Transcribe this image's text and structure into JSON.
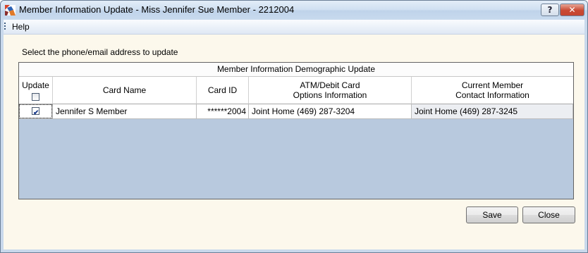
{
  "window": {
    "title": "Member Information Update - Miss Jennifer Sue Member - 2212004",
    "help_glyph": "?",
    "close_glyph": "✕",
    "app_icon": "app-logo-icon"
  },
  "menu": {
    "items": [
      "Help"
    ]
  },
  "instruction": "Select the phone/email address to update",
  "grid": {
    "caption": "Member Information Demographic Update",
    "columns": {
      "update": "Update",
      "card_name": "Card Name",
      "card_id": "Card ID",
      "atm_line1": "ATM/Debit Card",
      "atm_line2": "Options Information",
      "current_line1": "Current Member",
      "current_line2": "Contact Information"
    },
    "header_checkbox_checked": false,
    "rows": [
      {
        "update": true,
        "card_name": "Jennifer S Member",
        "card_id": "******2004",
        "atm_info": "Joint Home (469) 287-3204",
        "current_info": "Joint Home (469) 287-3245"
      }
    ]
  },
  "buttons": {
    "save": "Save",
    "close": "Close"
  },
  "colors": {
    "grid_background": "#b8c9de",
    "client_background": "#fcf8ec",
    "close_button": "#c94a33"
  }
}
